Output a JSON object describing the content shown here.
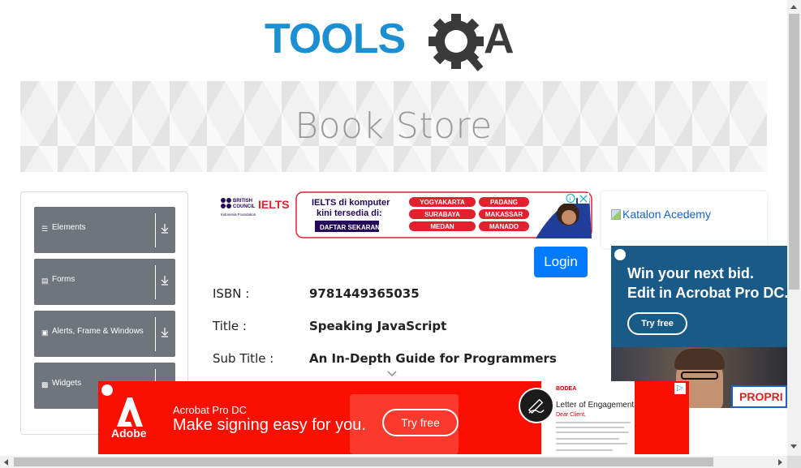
{
  "logo": {
    "text_left": "TOOLS",
    "text_right": "QA"
  },
  "banner": {
    "title": "Book Store"
  },
  "sidebar": {
    "groups": [
      {
        "label": "Elements",
        "icon": "menu-icon"
      },
      {
        "label": "Forms",
        "icon": "form-icon"
      },
      {
        "label": "Alerts, Frame & Windows",
        "icon": "window-icon"
      },
      {
        "label": "Widgets",
        "icon": "widgets-icon"
      }
    ]
  },
  "ad_top": {
    "brand_left": "BRITISH COUNCIL",
    "brand_sub": "Indonesia Foundation",
    "brand_ielts": "IELTS",
    "headline_1": "IELTS di komputer",
    "headline_2": "kini tersedia di:",
    "cta": "DAFTAR SEKARANG",
    "cities": [
      "YOGYAKARTA",
      "PADANG",
      "SURABAYA",
      "MAKASSAR",
      "MEDAN",
      "MANADO"
    ]
  },
  "login": {
    "label": "Login"
  },
  "book": {
    "fields": [
      {
        "label": "ISBN :",
        "value": "9781449365035"
      },
      {
        "label": "Title :",
        "value": "Speaking JavaScript"
      },
      {
        "label": "Sub Title :",
        "value": "An In-Depth Guide for Programmers"
      }
    ]
  },
  "right": {
    "katalon_alt": "Katalon Acedemy",
    "ad_line_1": "Win your next bid.",
    "ad_line_2": "Edit in Acrobat Pro DC.",
    "ad_button": "Try free",
    "ad_corner_text": "PROPRI"
  },
  "ad_bottom": {
    "brand": "Adobe",
    "product": "Acrobat Pro DC",
    "headline": "Make signing easy for you.",
    "button": "Try free",
    "doc_brand": "BODEA",
    "doc_title": "Letter of Engagement",
    "doc_sub": "Dear Client,"
  },
  "colors": {
    "accent": "#007bff",
    "logo_blue": "#1b8fd1",
    "logo_dark": "#3a3a3a",
    "sidebar_group": "#70757c",
    "adobe_red": "#fa0f00"
  }
}
